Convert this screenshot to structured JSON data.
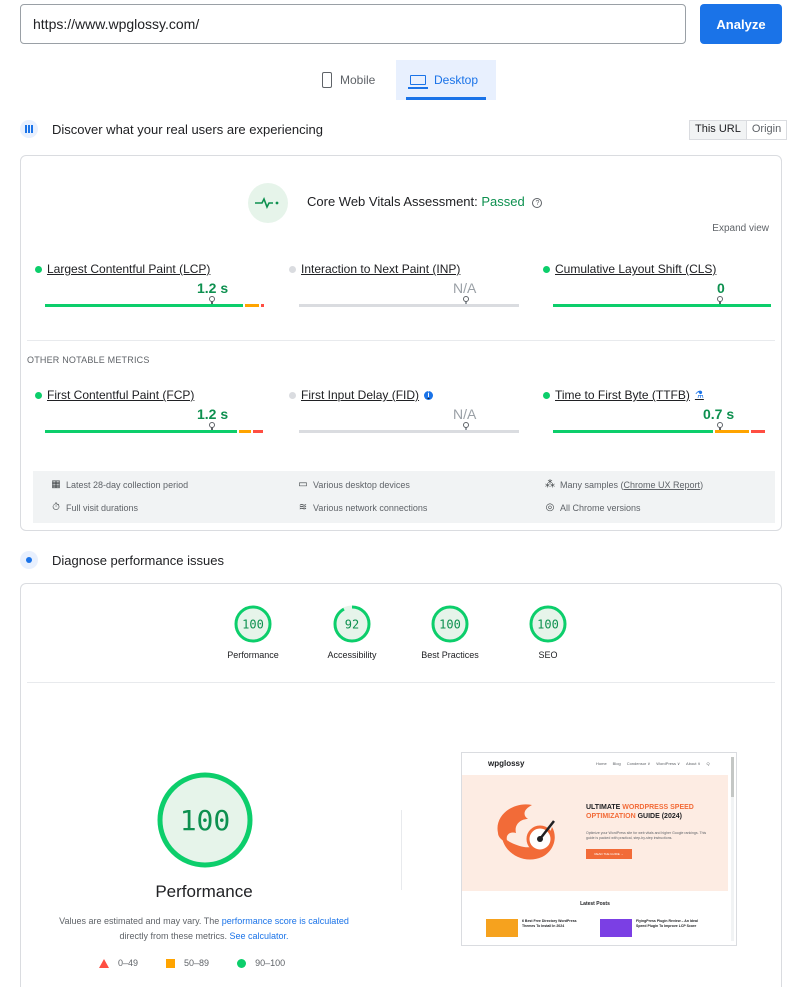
{
  "url_bar": {
    "value": "https://www.wpglossy.com/",
    "analyze_label": "Analyze"
  },
  "device_tabs": {
    "mobile": "Mobile",
    "desktop": "Desktop",
    "selected": "Desktop"
  },
  "field_data": {
    "heading": "Discover what your real users are experiencing",
    "toggle_this_url": "This URL",
    "toggle_origin": "Origin",
    "assessment_label": "Core Web Vitals Assessment:",
    "assessment_result": "Passed",
    "expand_view": "Expand view",
    "core_metrics": [
      {
        "name": "Largest Contentful Paint (LCP)",
        "value": "1.2 s",
        "status": "good"
      },
      {
        "name": "Interaction to Next Paint (INP)",
        "value": "N/A",
        "status": "none"
      },
      {
        "name": "Cumulative Layout Shift (CLS)",
        "value": "0",
        "status": "good"
      }
    ],
    "other_label": "OTHER NOTABLE METRICS",
    "other_metrics": [
      {
        "name": "First Contentful Paint (FCP)",
        "value": "1.2 s",
        "status": "good"
      },
      {
        "name": "First Input Delay (FID)",
        "value": "N/A",
        "status": "none"
      },
      {
        "name": "Time to First Byte (TTFB)",
        "value": "0.7 s",
        "status": "good"
      }
    ],
    "footer": {
      "collection_period": "Latest 28-day collection period",
      "devices": "Various desktop devices",
      "samples_prefix": "Many samples (",
      "samples_link": "Chrome UX Report",
      "samples_suffix": ")",
      "visit_durations": "Full visit durations",
      "network": "Various network connections",
      "chrome_versions": "All Chrome versions"
    }
  },
  "diagnose": {
    "heading": "Diagnose performance issues",
    "scores": [
      {
        "label": "Performance",
        "value": "100",
        "score": 100
      },
      {
        "label": "Accessibility",
        "value": "92",
        "score": 92
      },
      {
        "label": "Best Practices",
        "value": "100",
        "score": 100
      },
      {
        "label": "SEO",
        "value": "100",
        "score": 100
      }
    ],
    "big_score": "100",
    "big_label": "Performance",
    "note_prefix": "Values are estimated and may vary. The ",
    "note_link1": "performance score is calculated",
    "note_mid": " directly from these metrics. ",
    "note_link2": "See calculator.",
    "legend": {
      "bad": "0–49",
      "average": "50–89",
      "good": "90–100"
    }
  },
  "screenshot": {
    "logo": "wpglossy",
    "nav": [
      "Home",
      "Blog",
      "Condensor ∨",
      "WordPress ∨",
      "About ∨",
      "Q"
    ],
    "hero_title_1": "ULTIMATE ",
    "hero_title_accent": "WORDPRESS SPEED OPTIMIZATION",
    "hero_title_2": " GUIDE (2024)",
    "hero_text": "Optimize your WordPress site for web vitals and higher Google rankings. This guide is packed with practical, step-by-step instructions.",
    "hero_button": "READ THE GUIDE →",
    "latest_posts": "Latest Posts",
    "posts": [
      {
        "title": "6 Best Free Directory WordPress Themes To Install In 2024",
        "thumb_text": "Best Free Directory Themes"
      },
      {
        "title": "FlyingPress Plugin Review – An Ideal Speed Plugin To Improve LCP Score",
        "thumb_text": "FlyingPress Review"
      }
    ]
  },
  "colors": {
    "accent": "#1a73e8",
    "good": "#0cce6b",
    "average": "#ffa400",
    "poor": "#ff4e42",
    "passed_text": "#0d904f"
  }
}
